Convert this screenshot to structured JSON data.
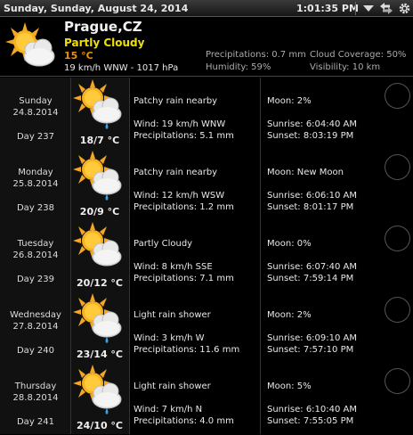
{
  "titlebar": {
    "date": "Sunday, Sunday, August 24, 2014",
    "time": "1:01:35 PM",
    "icons": [
      "dropdown-arrow-icon",
      "swap-arrows-icon",
      "gear-icon"
    ]
  },
  "current": {
    "city": "Prague,CZ",
    "condition": "Partly Cloudy",
    "temperature": "15 °C",
    "wind_pressure": "19 km/h WNW - 1017 hPa",
    "precipitations": "Precipitations: 0.7 mm",
    "humidity": "Humidity: 59%",
    "cloud_coverage": "Cloud Coverage: 50%",
    "visibility": "Visibility: 10 km",
    "icon": "partly-cloudy-icon"
  },
  "forecast": [
    {
      "day": "Sunday",
      "date": "24.8.2014",
      "day_num": "Day 237",
      "temp": "18/7 °C",
      "icon": "sun-cloud-rain-icon",
      "condition": "Patchy rain nearby",
      "wind": "Wind: 19 km/h WNW",
      "precip": "Precipitations: 5.1 mm",
      "moon": "Moon: 2%",
      "sunrise": "Sunrise: 6:04:40 AM",
      "sunset": "Sunset: 8:03:19 PM"
    },
    {
      "day": "Monday",
      "date": "25.8.2014",
      "day_num": "Day 238",
      "temp": "20/9 °C",
      "icon": "sun-cloud-rain-icon",
      "condition": "Patchy rain nearby",
      "wind": "Wind: 12 km/h WSW",
      "precip": "Precipitations: 1.2 mm",
      "moon": "Moon: New Moon",
      "sunrise": "Sunrise: 6:06:10 AM",
      "sunset": "Sunset: 8:01:17 PM"
    },
    {
      "day": "Tuesday",
      "date": "26.8.2014",
      "day_num": "Day 239",
      "temp": "20/12 °C",
      "icon": "partly-cloudy-icon",
      "condition": "Partly Cloudy",
      "wind": "Wind: 8 km/h SSE",
      "precip": "Precipitations: 7.1 mm",
      "moon": "Moon: 0%",
      "sunrise": "Sunrise: 6:07:40 AM",
      "sunset": "Sunset: 7:59:14 PM"
    },
    {
      "day": "Wednesday",
      "date": "27.8.2014",
      "day_num": "Day 240",
      "temp": "23/14 °C",
      "icon": "sun-cloud-rain-icon",
      "condition": "Light rain shower",
      "wind": "Wind: 3 km/h W",
      "precip": "Precipitations: 11.6 mm",
      "moon": "Moon: 2%",
      "sunrise": "Sunrise: 6:09:10 AM",
      "sunset": "Sunset: 7:57:10 PM"
    },
    {
      "day": "Thursday",
      "date": "28.8.2014",
      "day_num": "Day 241",
      "temp": "24/10 °C",
      "icon": "sun-cloud-rain-icon",
      "condition": "Light rain shower",
      "wind": "Wind: 7 km/h N",
      "precip": "Precipitations: 4.0 mm",
      "moon": "Moon: 5%",
      "sunrise": "Sunrise: 6:10:40 AM",
      "sunset": "Sunset: 7:55:05 PM"
    }
  ],
  "colors": {
    "condition_yellow": "#f0e000",
    "temp_orange": "#f09000",
    "sun": "#f5a623"
  }
}
